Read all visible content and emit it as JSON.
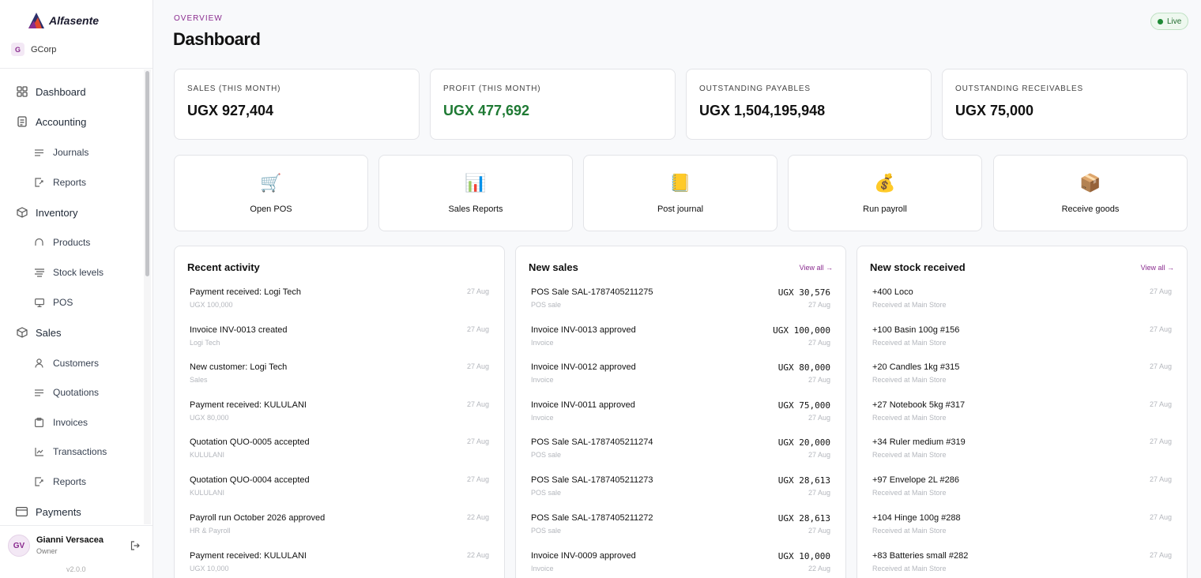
{
  "sidebar": {
    "brand": "Alfasente",
    "org_initial": "G",
    "org_name": "GCorp",
    "nav": [
      {
        "label": "Dashboard",
        "icon": "grid-icon",
        "level": "top"
      },
      {
        "label": "Accounting",
        "icon": "document-icon",
        "level": "top"
      },
      {
        "label": "Journals",
        "icon": "lines-icon",
        "level": "sub"
      },
      {
        "label": "Reports",
        "icon": "report-icon",
        "level": "sub"
      },
      {
        "label": "Inventory",
        "icon": "box-icon",
        "level": "top"
      },
      {
        "label": "Products",
        "icon": "arc-icon",
        "level": "sub"
      },
      {
        "label": "Stock levels",
        "icon": "stack-icon",
        "level": "sub"
      },
      {
        "label": "POS",
        "icon": "monitor-icon",
        "level": "sub"
      },
      {
        "label": "Sales",
        "icon": "box-icon",
        "level": "top"
      },
      {
        "label": "Customers",
        "icon": "person-icon",
        "level": "sub"
      },
      {
        "label": "Quotations",
        "icon": "lines-icon",
        "level": "sub"
      },
      {
        "label": "Invoices",
        "icon": "clipboard-icon",
        "level": "sub"
      },
      {
        "label": "Transactions",
        "icon": "chart-icon",
        "level": "sub"
      },
      {
        "label": "Reports",
        "icon": "report-icon",
        "level": "sub"
      },
      {
        "label": "Payments",
        "icon": "card-icon",
        "level": "top"
      }
    ],
    "user": {
      "initials": "GV",
      "name": "Gianni Versacea",
      "role": "Owner"
    },
    "version": "v2.0.0"
  },
  "header": {
    "eyebrow": "OVERVIEW",
    "title": "Dashboard",
    "status": "Live"
  },
  "stats": [
    {
      "label": "SALES (THIS MONTH)",
      "value": "UGX 927,404",
      "accent": "#111111"
    },
    {
      "label": "PROFIT (THIS MONTH)",
      "value": "UGX 477,692",
      "accent": "#1f7a34"
    },
    {
      "label": "OUTSTANDING PAYABLES",
      "value": "UGX 1,504,195,948",
      "accent": "#111111"
    },
    {
      "label": "OUTSTANDING RECEIVABLES",
      "value": "UGX 75,000",
      "accent": "#111111"
    }
  ],
  "actions": [
    {
      "label": "Open POS",
      "icon": "cart-icon",
      "glyph": "🛒"
    },
    {
      "label": "Sales Reports",
      "icon": "bar-chart-icon",
      "glyph": "📊"
    },
    {
      "label": "Post journal",
      "icon": "ledger-icon",
      "glyph": "📒"
    },
    {
      "label": "Run payroll",
      "icon": "money-bag-icon",
      "glyph": "💰"
    },
    {
      "label": "Receive goods",
      "icon": "package-icon",
      "glyph": "📦"
    }
  ],
  "recent_activity": {
    "title": "Recent activity",
    "items": [
      {
        "title": "Payment received: Logi Tech",
        "sub": "UGX 100,000",
        "date": "27 Aug"
      },
      {
        "title": "Invoice INV-0013 created",
        "sub": "Logi Tech",
        "date": "27 Aug"
      },
      {
        "title": "New customer: Logi Tech",
        "sub": "Sales",
        "date": "27 Aug"
      },
      {
        "title": "Payment received: KULULANI",
        "sub": "UGX 80,000",
        "date": "27 Aug"
      },
      {
        "title": "Quotation QUO-0005 accepted",
        "sub": "KULULANI",
        "date": "27 Aug"
      },
      {
        "title": "Quotation QUO-0004 accepted",
        "sub": "KULULANI",
        "date": "27 Aug"
      },
      {
        "title": "Payroll run October 2026 approved",
        "sub": "HR & Payroll",
        "date": "22 Aug"
      },
      {
        "title": "Payment received: KULULANI",
        "sub": "UGX 10,000",
        "date": "22 Aug"
      }
    ]
  },
  "new_sales": {
    "title": "New sales",
    "link": "View all →",
    "items": [
      {
        "title": "POS Sale SAL-1787405211275",
        "sub": "POS sale",
        "amount": "UGX 30,576",
        "date": "27 Aug"
      },
      {
        "title": "Invoice INV-0013 approved",
        "sub": "Invoice",
        "amount": "UGX 100,000",
        "date": "27 Aug"
      },
      {
        "title": "Invoice INV-0012 approved",
        "sub": "Invoice",
        "amount": "UGX 80,000",
        "date": "27 Aug"
      },
      {
        "title": "Invoice INV-0011 approved",
        "sub": "Invoice",
        "amount": "UGX 75,000",
        "date": "27 Aug"
      },
      {
        "title": "POS Sale SAL-1787405211274",
        "sub": "POS sale",
        "amount": "UGX 20,000",
        "date": "27 Aug"
      },
      {
        "title": "POS Sale SAL-1787405211273",
        "sub": "POS sale",
        "amount": "UGX 28,613",
        "date": "27 Aug"
      },
      {
        "title": "POS Sale SAL-1787405211272",
        "sub": "POS sale",
        "amount": "UGX 28,613",
        "date": "27 Aug"
      },
      {
        "title": "Invoice INV-0009 approved",
        "sub": "Invoice",
        "amount": "UGX 10,000",
        "date": "22 Aug"
      }
    ]
  },
  "new_stock": {
    "title": "New stock received",
    "link": "View all →",
    "items": [
      {
        "title": "+400 Loco",
        "sub": "Received at Main Store",
        "date": "27 Aug"
      },
      {
        "title": "+100 Basin 100g #156",
        "sub": "Received at Main Store",
        "date": "27 Aug"
      },
      {
        "title": "+20 Candles 1kg #315",
        "sub": "Received at Main Store",
        "date": "27 Aug"
      },
      {
        "title": "+27 Notebook 5kg #317",
        "sub": "Received at Main Store",
        "date": "27 Aug"
      },
      {
        "title": "+34 Ruler medium #319",
        "sub": "Received at Main Store",
        "date": "27 Aug"
      },
      {
        "title": "+97 Envelope 2L #286",
        "sub": "Received at Main Store",
        "date": "27 Aug"
      },
      {
        "title": "+104 Hinge 100g #288",
        "sub": "Received at Main Store",
        "date": "27 Aug"
      },
      {
        "title": "+83 Batteries small #282",
        "sub": "Received at Main Store",
        "date": "27 Aug"
      }
    ]
  }
}
